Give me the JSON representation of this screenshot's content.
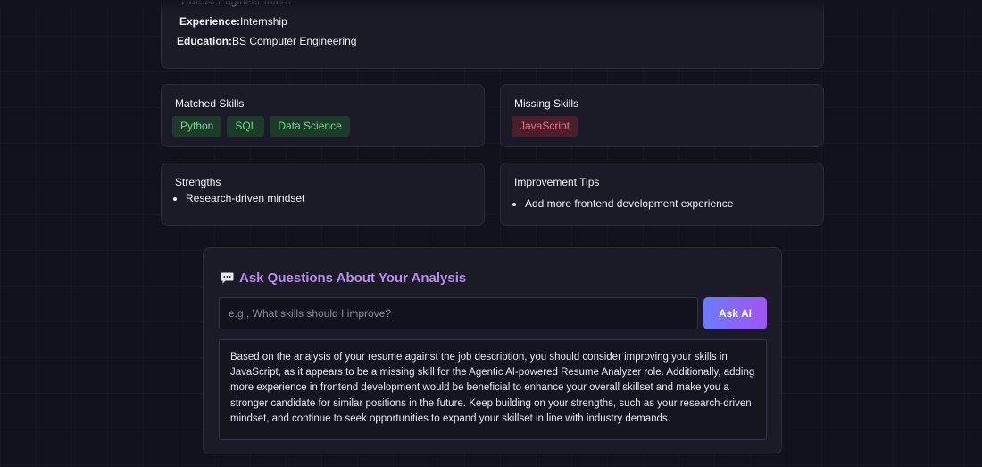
{
  "profile": {
    "title_label": "Title:",
    "title_value": "AI Engineer Intern",
    "experience_label": "Experience:",
    "experience_value": "Internship",
    "education_label": "Education:",
    "education_value": "BS Computer Engineering"
  },
  "matched_skills": {
    "heading": "Matched Skills",
    "tags": [
      "Python",
      "SQL",
      "Data Science"
    ]
  },
  "missing_skills": {
    "heading": "Missing Skills",
    "tags": [
      "JavaScript"
    ]
  },
  "strengths": {
    "heading": "Strengths",
    "items": [
      "Research-driven mindset"
    ]
  },
  "improvement_tips": {
    "heading": "Improvement Tips",
    "items": [
      "Add more frontend development experience"
    ]
  },
  "ask": {
    "heading": "Ask Questions About Your Analysis",
    "icon": "speech-bubble-icon",
    "placeholder": "e.g., What skills should I improve?",
    "button_label": "Ask AI",
    "answer": "Based on the analysis of your resume against the job description, you should consider improving your skills in JavaScript, as it appears to be a missing skill for the Agentic AI-powered Resume Analyzer role. Additionally, adding more experience in frontend development would be beneficial to enhance your overall skillset and make you a stronger candidate for similar positions in the future. Keep building on your strengths, such as your research-driven mindset, and continue to seek opportunities to expand your skillset in line with industry demands."
  },
  "colors": {
    "background": "#12121d",
    "card": "#1b1b27",
    "accent_purple": "#b98bee",
    "match_tag_text": "#6fdb8e",
    "missing_tag_text": "#f07287"
  }
}
